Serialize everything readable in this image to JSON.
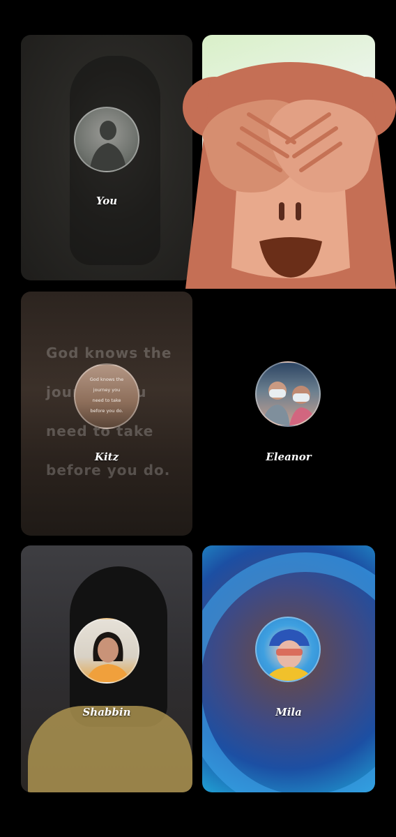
{
  "participants": [
    {
      "name": "You"
    },
    {
      "name": "Kitz"
    },
    {
      "name": "Eleanor"
    },
    {
      "name": "Shabbin"
    },
    {
      "name": "Mila"
    }
  ],
  "kitz_background_quote": [
    "God knows the",
    "journey you",
    "need to take",
    "before you do."
  ],
  "kitz_avatar_quote": [
    "God knows the",
    "journey you",
    "need to take",
    "before you do."
  ],
  "overlay_emoji": "see-no-evil-monkey-icon"
}
